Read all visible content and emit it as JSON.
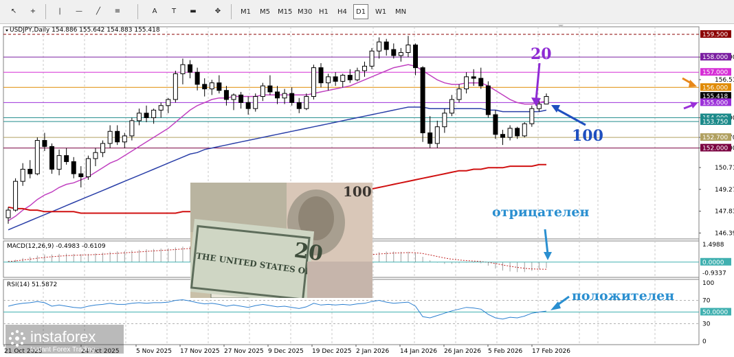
{
  "toolbar": {
    "tools": [
      {
        "name": "cursor-icon",
        "glyph": "↖"
      },
      {
        "name": "crosshair-icon",
        "glyph": "+"
      },
      {
        "name": "vertical-line-icon",
        "glyph": "|"
      },
      {
        "name": "horizontal-line-icon",
        "glyph": "—"
      },
      {
        "name": "trendline-icon",
        "glyph": "╱"
      },
      {
        "name": "fibonacci-icon",
        "glyph": "≡"
      },
      {
        "name": "text-icon",
        "glyph": "A"
      },
      {
        "name": "text-label-icon",
        "glyph": "T"
      },
      {
        "name": "rectangle-icon",
        "glyph": "▬"
      },
      {
        "name": "arrows-icon",
        "glyph": "✥"
      }
    ],
    "timeframes": [
      "M1",
      "M5",
      "M15",
      "M30",
      "H1",
      "H4",
      "D1",
      "W1",
      "MN"
    ],
    "active_timeframe": "D1"
  },
  "chart_data": {
    "type": "candlestick",
    "title": "USDJPY,Daily  154.886 155.642 154.883 155.418",
    "symbol": "USDJPY",
    "timeframe": "Daily",
    "ohlc_last": {
      "open": 154.886,
      "high": 155.642,
      "low": 154.883,
      "close": 155.418
    },
    "ylim": [
      146.0,
      160.0
    ],
    "price_ticks": [
      "158.000",
      "156.510",
      "154.000",
      "152.700",
      "152.000",
      "150.710",
      "149.270",
      "147.830",
      "146.390"
    ],
    "price_tick_values": [
      158.0,
      156.51,
      154.0,
      152.7,
      152.0,
      150.71,
      149.27,
      147.83,
      146.39
    ],
    "price_markers": [
      {
        "label": "159.500",
        "value": 159.5,
        "color": "#8b0000"
      },
      {
        "label": "158.000",
        "value": 158.0,
        "color": "#7a1ea1"
      },
      {
        "label": "157.000",
        "value": 157.0,
        "color": "#d62fd6"
      },
      {
        "label": "156.000",
        "value": 156.0,
        "color": "#e08a00"
      },
      {
        "label": "155.418",
        "value": 155.418,
        "color": "#000000"
      },
      {
        "label": "155.000",
        "value": 155.0,
        "color": "#9b30d9"
      },
      {
        "label": "154.000",
        "value": 154.0,
        "color": "#1c8a8a"
      },
      {
        "label": "153.750",
        "value": 153.75,
        "color": "#1c8a8a"
      },
      {
        "label": "152.700",
        "value": 152.7,
        "color": "#b0a060"
      },
      {
        "label": "152.000",
        "value": 152.0,
        "color": "#7a0040"
      }
    ],
    "x_ticks": [
      "21 Oct 2025",
      "24 Oct 2025",
      "5 Nov 2025",
      "17 Nov 2025",
      "27 Nov 2025",
      "9 Dec 2025",
      "19 Dec 2025",
      "2 Jan 2026",
      "14 Jan 2026",
      "26 Jan 2026",
      "5 Feb 2026",
      "17 Feb 2026"
    ],
    "candles": [
      [
        147.4,
        148.1,
        147.0,
        147.9
      ],
      [
        147.9,
        150.0,
        147.8,
        149.8
      ],
      [
        149.8,
        151.0,
        149.5,
        150.6
      ],
      [
        150.6,
        151.2,
        150.0,
        150.3
      ],
      [
        150.3,
        152.7,
        150.2,
        152.5
      ],
      [
        152.5,
        153.0,
        151.8,
        152.1
      ],
      [
        152.1,
        152.3,
        150.3,
        150.6
      ],
      [
        150.6,
        151.9,
        150.2,
        151.5
      ],
      [
        151.5,
        152.0,
        150.9,
        151.1
      ],
      [
        151.1,
        151.4,
        150.0,
        150.3
      ],
      [
        150.3,
        150.8,
        149.4,
        150.1
      ],
      [
        150.1,
        151.5,
        149.9,
        151.3
      ],
      [
        151.3,
        152.0,
        150.8,
        151.7
      ],
      [
        151.7,
        152.5,
        151.4,
        152.3
      ],
      [
        152.3,
        153.5,
        152.0,
        153.1
      ],
      [
        153.1,
        153.5,
        152.2,
        152.4
      ],
      [
        152.4,
        153.0,
        152.0,
        152.8
      ],
      [
        152.8,
        154.0,
        152.5,
        153.8
      ],
      [
        153.8,
        154.6,
        153.5,
        154.3
      ],
      [
        154.3,
        154.8,
        153.7,
        154.0
      ],
      [
        154.0,
        154.6,
        153.6,
        154.5
      ],
      [
        154.5,
        155.0,
        154.0,
        154.8
      ],
      [
        154.8,
        155.3,
        154.3,
        155.2
      ],
      [
        155.2,
        157.1,
        155.0,
        156.9
      ],
      [
        156.9,
        157.9,
        156.2,
        157.5
      ],
      [
        157.5,
        157.8,
        156.6,
        157.0
      ],
      [
        157.0,
        157.3,
        155.8,
        156.2
      ],
      [
        156.2,
        156.6,
        155.4,
        155.9
      ],
      [
        155.9,
        156.5,
        155.5,
        156.3
      ],
      [
        156.3,
        156.8,
        155.6,
        155.8
      ],
      [
        155.8,
        156.1,
        154.8,
        155.2
      ],
      [
        155.2,
        155.6,
        154.5,
        155.5
      ],
      [
        155.5,
        155.7,
        154.6,
        155.0
      ],
      [
        155.0,
        155.4,
        154.2,
        154.6
      ],
      [
        154.6,
        155.6,
        154.4,
        155.4
      ],
      [
        155.4,
        156.3,
        155.1,
        156.1
      ],
      [
        156.1,
        156.8,
        155.5,
        155.7
      ],
      [
        155.7,
        156.1,
        154.9,
        155.3
      ],
      [
        155.3,
        155.9,
        154.9,
        155.6
      ],
      [
        155.6,
        156.0,
        154.8,
        155.0
      ],
      [
        155.0,
        155.3,
        154.3,
        154.6
      ],
      [
        154.6,
        155.6,
        154.5,
        155.4
      ],
      [
        155.4,
        157.5,
        155.2,
        157.3
      ],
      [
        157.3,
        157.6,
        156.0,
        156.3
      ],
      [
        156.3,
        156.9,
        155.8,
        156.7
      ],
      [
        156.7,
        157.0,
        156.1,
        156.4
      ],
      [
        156.4,
        156.9,
        156.0,
        156.8
      ],
      [
        156.8,
        157.2,
        156.3,
        156.5
      ],
      [
        156.5,
        157.3,
        156.4,
        157.1
      ],
      [
        157.1,
        157.7,
        156.7,
        157.4
      ],
      [
        157.4,
        158.6,
        157.2,
        158.4
      ],
      [
        158.4,
        159.3,
        157.9,
        159.0
      ],
      [
        159.0,
        159.2,
        158.1,
        158.5
      ],
      [
        158.5,
        158.9,
        157.9,
        158.1
      ],
      [
        158.1,
        158.6,
        157.7,
        158.3
      ],
      [
        158.3,
        159.4,
        158.0,
        158.8
      ],
      [
        158.8,
        158.9,
        156.8,
        157.3
      ],
      [
        157.3,
        157.4,
        152.4,
        153.0
      ],
      [
        153.0,
        154.1,
        152.0,
        152.3
      ],
      [
        152.3,
        153.8,
        152.0,
        153.4
      ],
      [
        153.4,
        154.6,
        153.0,
        154.3
      ],
      [
        154.3,
        155.5,
        154.1,
        155.2
      ],
      [
        155.2,
        156.2,
        155.0,
        155.9
      ],
      [
        155.9,
        157.0,
        155.6,
        156.7
      ],
      [
        156.7,
        157.2,
        156.1,
        156.6
      ],
      [
        156.6,
        157.3,
        155.9,
        156.1
      ],
      [
        156.1,
        156.4,
        154.0,
        154.2
      ],
      [
        154.2,
        154.5,
        152.6,
        152.9
      ],
      [
        152.9,
        153.2,
        152.2,
        152.7
      ],
      [
        152.7,
        153.5,
        152.5,
        153.3
      ],
      [
        153.3,
        153.4,
        152.6,
        152.8
      ],
      [
        152.8,
        153.7,
        152.7,
        153.6
      ],
      [
        153.6,
        154.8,
        153.4,
        154.6
      ],
      [
        154.6,
        155.3,
        154.4,
        154.9
      ],
      [
        154.9,
        155.6,
        154.9,
        155.4
      ]
    ],
    "ma_lines": [
      {
        "period": 20,
        "color": "#c040c0",
        "values": [
          147.2,
          147.5,
          147.9,
          148.2,
          148.6,
          148.9,
          149.1,
          149.4,
          149.6,
          149.7,
          149.9,
          150.1,
          150.4,
          150.7,
          151.0,
          151.2,
          151.5,
          151.8,
          152.1,
          152.4,
          152.7,
          153.0,
          153.3,
          153.7,
          154.1,
          154.5,
          154.8,
          155.0,
          155.2,
          155.3,
          155.3,
          155.4,
          155.4,
          155.4,
          155.4,
          155.5,
          155.5,
          155.5,
          155.5,
          155.5,
          155.5,
          155.5,
          155.6,
          155.7,
          155.8,
          155.9,
          156.0,
          156.1,
          156.3,
          156.5,
          156.7,
          156.9,
          157.1,
          157.3,
          157.4,
          157.5,
          157.4,
          157.1,
          156.8,
          156.5,
          156.3,
          156.2,
          156.2,
          156.3,
          156.3,
          156.3,
          156.1,
          155.8,
          155.5,
          155.2,
          155.0,
          154.9,
          154.9,
          155.0,
          155.1
        ]
      },
      {
        "period": 100,
        "color": "#2a3fa8",
        "values": [
          146.6,
          146.8,
          147.0,
          147.2,
          147.4,
          147.6,
          147.8,
          148.0,
          148.2,
          148.4,
          148.6,
          148.8,
          149.0,
          149.2,
          149.4,
          149.6,
          149.8,
          150.0,
          150.2,
          150.4,
          150.6,
          150.8,
          151.0,
          151.2,
          151.4,
          151.6,
          151.7,
          151.9,
          152.0,
          152.1,
          152.2,
          152.3,
          152.4,
          152.5,
          152.6,
          152.7,
          152.8,
          152.9,
          153.0,
          153.1,
          153.2,
          153.3,
          153.4,
          153.5,
          153.6,
          153.7,
          153.8,
          153.9,
          154.0,
          154.1,
          154.2,
          154.3,
          154.4,
          154.5,
          154.6,
          154.7,
          154.7,
          154.7,
          154.6,
          154.6,
          154.6,
          154.6,
          154.6,
          154.6,
          154.6,
          154.6,
          154.5,
          154.5,
          154.4,
          154.4,
          154.4,
          154.4,
          154.4,
          154.4,
          154.5
        ]
      },
      {
        "period": 200,
        "color": "#d01010",
        "values": [
          148.1,
          148.0,
          148.0,
          147.9,
          147.9,
          147.8,
          147.8,
          147.8,
          147.8,
          147.8,
          147.7,
          147.7,
          147.7,
          147.7,
          147.7,
          147.7,
          147.7,
          147.7,
          147.7,
          147.7,
          147.7,
          147.7,
          147.7,
          147.7,
          147.8,
          147.8,
          147.8,
          147.8,
          147.8,
          147.9,
          147.9,
          147.9,
          147.9,
          148.0,
          148.0,
          148.1,
          148.1,
          148.2,
          148.2,
          148.3,
          148.3,
          148.4,
          148.5,
          148.6,
          148.7,
          148.8,
          148.9,
          149.0,
          149.1,
          149.2,
          149.3,
          149.4,
          149.5,
          149.6,
          149.7,
          149.8,
          149.9,
          150.0,
          150.1,
          150.2,
          150.3,
          150.4,
          150.5,
          150.5,
          150.6,
          150.6,
          150.7,
          150.7,
          150.7,
          150.8,
          150.8,
          150.8,
          150.8,
          150.9,
          150.9
        ]
      }
    ],
    "macd": {
      "label": "MACD(12,26,9) -0.4983 -0.6109",
      "ticks": [
        "1.4988",
        "0.0000",
        "-0.9337"
      ],
      "tick_values": [
        1.4988,
        0.0,
        -0.9337
      ],
      "ylim": [
        -1.3,
        1.8
      ],
      "histogram": [
        0.1,
        0.2,
        0.35,
        0.45,
        0.55,
        0.65,
        0.65,
        0.7,
        0.72,
        0.7,
        0.68,
        0.7,
        0.74,
        0.8,
        0.88,
        0.92,
        0.95,
        1.0,
        1.05,
        1.1,
        1.12,
        1.15,
        1.18,
        1.25,
        1.32,
        1.35,
        1.3,
        1.22,
        1.15,
        1.05,
        0.95,
        0.88,
        0.8,
        0.72,
        0.7,
        0.72,
        0.7,
        0.65,
        0.62,
        0.58,
        0.52,
        0.5,
        0.6,
        0.62,
        0.62,
        0.6,
        0.6,
        0.58,
        0.6,
        0.65,
        0.75,
        0.85,
        0.9,
        0.9,
        0.88,
        0.88,
        0.78,
        0.45,
        0.15,
        -0.05,
        -0.15,
        -0.15,
        -0.1,
        -0.05,
        -0.05,
        -0.1,
        -0.3,
        -0.55,
        -0.72,
        -0.8,
        -0.85,
        -0.85,
        -0.75,
        -0.62,
        -0.5
      ],
      "signal": [
        0.05,
        0.1,
        0.18,
        0.25,
        0.33,
        0.4,
        0.46,
        0.51,
        0.55,
        0.58,
        0.6,
        0.62,
        0.64,
        0.67,
        0.71,
        0.75,
        0.79,
        0.83,
        0.87,
        0.91,
        0.95,
        0.99,
        1.03,
        1.07,
        1.12,
        1.16,
        1.19,
        1.2,
        1.19,
        1.17,
        1.12,
        1.07,
        1.01,
        0.95,
        0.9,
        0.86,
        0.83,
        0.8,
        0.77,
        0.74,
        0.7,
        0.66,
        0.65,
        0.64,
        0.64,
        0.63,
        0.63,
        0.62,
        0.62,
        0.63,
        0.65,
        0.69,
        0.73,
        0.77,
        0.79,
        0.81,
        0.8,
        0.73,
        0.61,
        0.48,
        0.35,
        0.25,
        0.18,
        0.13,
        0.09,
        0.05,
        -0.02,
        -0.12,
        -0.24,
        -0.35,
        -0.45,
        -0.53,
        -0.58,
        -0.6,
        -0.61
      ]
    },
    "rsi": {
      "label": "RSI(14) 51.5872",
      "ticks": [
        "100",
        "70",
        "50.0000",
        "30",
        "0"
      ],
      "tick_values": [
        100,
        70,
        50,
        30,
        0
      ],
      "ylim": [
        0,
        100
      ],
      "values": [
        60,
        63,
        65,
        66,
        68,
        66,
        60,
        62,
        60,
        58,
        57,
        60,
        62,
        63,
        65,
        63,
        63,
        65,
        66,
        65,
        66,
        66,
        67,
        70,
        71,
        69,
        66,
        64,
        65,
        63,
        60,
        62,
        60,
        58,
        61,
        63,
        61,
        59,
        60,
        58,
        56,
        59,
        65,
        62,
        63,
        62,
        63,
        62,
        64,
        65,
        68,
        70,
        67,
        65,
        66,
        67,
        60,
        42,
        40,
        44,
        48,
        52,
        55,
        58,
        57,
        55,
        46,
        40,
        38,
        41,
        40,
        43,
        48,
        50,
        51.6
      ]
    },
    "annotations": {
      "ma20_label": "20",
      "ma100_label": "100",
      "macd_note": "отрицателен",
      "rsi_note": "положителен"
    }
  },
  "banknote": {
    "denomination_yen": "1000",
    "dollar_value": "20",
    "dollar_note_text": "THE UNITED STATES OF AMERICA"
  },
  "watermark": {
    "brand": "instaforex",
    "tagline": "Instant Forex Trading"
  },
  "colors": {
    "grid": "#c8c8c8",
    "bull_candle": "#ffffff",
    "bear_candle": "#000000",
    "annotation_purple": "#8e2bd4",
    "annotation_blue": "#1f4fbf",
    "annotation_cyan_text": "#2a8fd0",
    "watermark_bg": "#3a3a3a"
  }
}
